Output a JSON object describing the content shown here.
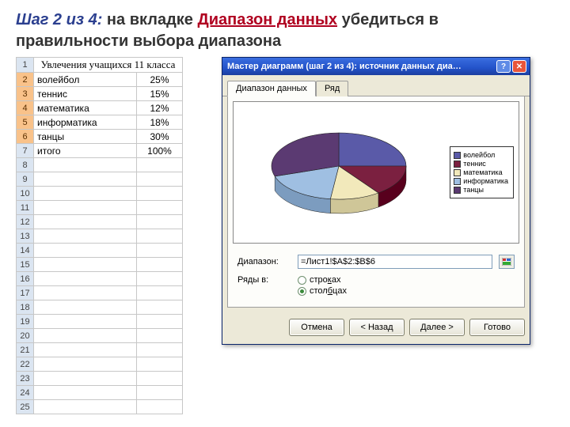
{
  "heading": {
    "step_prefix": "Шаг 2 из 4:",
    "text_before": " на вкладке ",
    "tab_name": "Диапазон данных",
    "text_after": " убедиться в правильности выбора диапазона"
  },
  "sheet": {
    "title": "Увлечения учащихся 11 класса",
    "rows": [
      {
        "n": 2,
        "a": "волейбол",
        "b": "25%",
        "sel": true
      },
      {
        "n": 3,
        "a": "теннис",
        "b": "15%",
        "sel": true
      },
      {
        "n": 4,
        "a": "математика",
        "b": "12%",
        "sel": true
      },
      {
        "n": 5,
        "a": "информатика",
        "b": "18%",
        "sel": true
      },
      {
        "n": 6,
        "a": "танцы",
        "b": "30%",
        "sel": true
      },
      {
        "n": 7,
        "a": "итого",
        "b": "100%",
        "sel": false
      }
    ],
    "empty_from": 8,
    "empty_to": 25
  },
  "wizard": {
    "title": "Мастер диаграмм (шаг 2 из 4): источник данных диа…",
    "tabs": {
      "data_range": "Диапазон данных",
      "series": "Ряд"
    },
    "form": {
      "range_label": "Диапазон:",
      "range_value": "=Лист1!$A$2:$B$6",
      "rows_in_label": "Ряды в:",
      "rows_option": "строках",
      "cols_option": "столбцах",
      "selected": "cols"
    },
    "buttons": {
      "cancel": "Отмена",
      "back": "< Назад",
      "next": "Далее >",
      "finish": "Готово"
    }
  },
  "chart_data": {
    "type": "pie",
    "title": "",
    "series": [
      {
        "name": "волейбол",
        "value": 25,
        "color": "#5a5aa8"
      },
      {
        "name": "теннис",
        "value": 15,
        "color": "#7b2040"
      },
      {
        "name": "математика",
        "value": 12,
        "color": "#f2e9bb"
      },
      {
        "name": "информатика",
        "value": 18,
        "color": "#9fbfe2"
      },
      {
        "name": "танцы",
        "value": 30,
        "color": "#5b3a72"
      }
    ]
  }
}
